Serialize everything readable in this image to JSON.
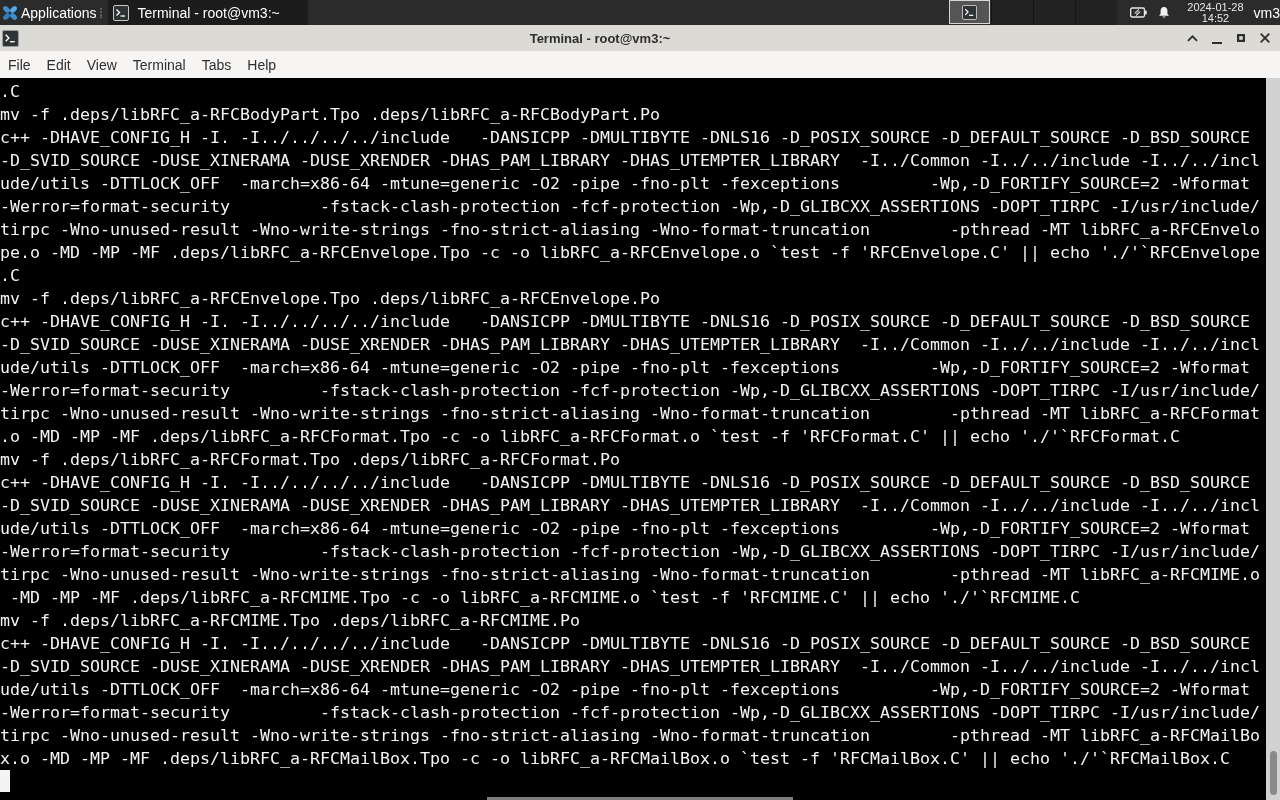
{
  "top_panel": {
    "applications_label": "Applications",
    "tasks": [
      {
        "title": "Terminal - root@vm3:~",
        "selected": true
      }
    ],
    "workspaces": [
      {
        "selected": true,
        "kind": "terminal"
      },
      {
        "selected": false,
        "kind": "empty"
      },
      {
        "selected": false,
        "kind": "empty"
      },
      {
        "selected": false,
        "kind": "empty"
      }
    ],
    "clock": {
      "date": "2024-01-28",
      "time": "14:52"
    },
    "user": "vm3"
  },
  "window": {
    "title": "Terminal - root@vm3:~"
  },
  "menu": [
    "File",
    "Edit",
    "View",
    "Terminal",
    "Tabs",
    "Help"
  ],
  "terminal": {
    "lines": [
      ".C",
      "mv -f .deps/libRFC_a-RFCBodyPart.Tpo .deps/libRFC_a-RFCBodyPart.Po",
      "c++ -DHAVE_CONFIG_H -I. -I../../../../include   -DANSICPP -DMULTIBYTE -DNLS16 -D_POSIX_SOURCE -D_DEFAULT_SOURCE -D_BSD_SOURCE",
      "-D_SVID_SOURCE -DUSE_XINERAMA -DUSE_XRENDER -DHAS_PAM_LIBRARY -DHAS_UTEMPTER_LIBRARY  -I../Common -I../../include -I../../incl",
      "ude/utils -DTTLOCK_OFF  -march=x86-64 -mtune=generic -O2 -pipe -fno-plt -fexceptions         -Wp,-D_FORTIFY_SOURCE=2 -Wformat",
      "-Werror=format-security         -fstack-clash-protection -fcf-protection -Wp,-D_GLIBCXX_ASSERTIONS -DOPT_TIRPC -I/usr/include/",
      "tirpc -Wno-unused-result -Wno-write-strings -fno-strict-aliasing -Wno-format-truncation        -pthread -MT libRFC_a-RFCEnvelo",
      "pe.o -MD -MP -MF .deps/libRFC_a-RFCEnvelope.Tpo -c -o libRFC_a-RFCEnvelope.o `test -f 'RFCEnvelope.C' || echo './'`RFCEnvelope",
      ".C",
      "mv -f .deps/libRFC_a-RFCEnvelope.Tpo .deps/libRFC_a-RFCEnvelope.Po",
      "c++ -DHAVE_CONFIG_H -I. -I../../../../include   -DANSICPP -DMULTIBYTE -DNLS16 -D_POSIX_SOURCE -D_DEFAULT_SOURCE -D_BSD_SOURCE",
      "-D_SVID_SOURCE -DUSE_XINERAMA -DUSE_XRENDER -DHAS_PAM_LIBRARY -DHAS_UTEMPTER_LIBRARY  -I../Common -I../../include -I../../incl",
      "ude/utils -DTTLOCK_OFF  -march=x86-64 -mtune=generic -O2 -pipe -fno-plt -fexceptions         -Wp,-D_FORTIFY_SOURCE=2 -Wformat",
      "-Werror=format-security         -fstack-clash-protection -fcf-protection -Wp,-D_GLIBCXX_ASSERTIONS -DOPT_TIRPC -I/usr/include/",
      "tirpc -Wno-unused-result -Wno-write-strings -fno-strict-aliasing -Wno-format-truncation        -pthread -MT libRFC_a-RFCFormat",
      ".o -MD -MP -MF .deps/libRFC_a-RFCFormat.Tpo -c -o libRFC_a-RFCFormat.o `test -f 'RFCFormat.C' || echo './'`RFCFormat.C",
      "mv -f .deps/libRFC_a-RFCFormat.Tpo .deps/libRFC_a-RFCFormat.Po",
      "c++ -DHAVE_CONFIG_H -I. -I../../../../include   -DANSICPP -DMULTIBYTE -DNLS16 -D_POSIX_SOURCE -D_DEFAULT_SOURCE -D_BSD_SOURCE",
      "-D_SVID_SOURCE -DUSE_XINERAMA -DUSE_XRENDER -DHAS_PAM_LIBRARY -DHAS_UTEMPTER_LIBRARY  -I../Common -I../../include -I../../incl",
      "ude/utils -DTTLOCK_OFF  -march=x86-64 -mtune=generic -O2 -pipe -fno-plt -fexceptions         -Wp,-D_FORTIFY_SOURCE=2 -Wformat",
      "-Werror=format-security         -fstack-clash-protection -fcf-protection -Wp,-D_GLIBCXX_ASSERTIONS -DOPT_TIRPC -I/usr/include/",
      "tirpc -Wno-unused-result -Wno-write-strings -fno-strict-aliasing -Wno-format-truncation        -pthread -MT libRFC_a-RFCMIME.o",
      " -MD -MP -MF .deps/libRFC_a-RFCMIME.Tpo -c -o libRFC_a-RFCMIME.o `test -f 'RFCMIME.C' || echo './'`RFCMIME.C",
      "mv -f .deps/libRFC_a-RFCMIME.Tpo .deps/libRFC_a-RFCMIME.Po",
      "c++ -DHAVE_CONFIG_H -I. -I../../../../include   -DANSICPP -DMULTIBYTE -DNLS16 -D_POSIX_SOURCE -D_DEFAULT_SOURCE -D_BSD_SOURCE",
      "-D_SVID_SOURCE -DUSE_XINERAMA -DUSE_XRENDER -DHAS_PAM_LIBRARY -DHAS_UTEMPTER_LIBRARY  -I../Common -I../../include -I../../incl",
      "ude/utils -DTTLOCK_OFF  -march=x86-64 -mtune=generic -O2 -pipe -fno-plt -fexceptions         -Wp,-D_FORTIFY_SOURCE=2 -Wformat",
      "-Werror=format-security         -fstack-clash-protection -fcf-protection -Wp,-D_GLIBCXX_ASSERTIONS -DOPT_TIRPC -I/usr/include/",
      "tirpc -Wno-unused-result -Wno-write-strings -fno-strict-aliasing -Wno-format-truncation        -pthread -MT libRFC_a-RFCMailBo",
      "x.o -MD -MP -MF .deps/libRFC_a-RFCMailBox.Tpo -c -o libRFC_a-RFCMailBox.o `test -f 'RFCMailBox.C' || echo './'`RFCMailBox.C"
    ]
  }
}
